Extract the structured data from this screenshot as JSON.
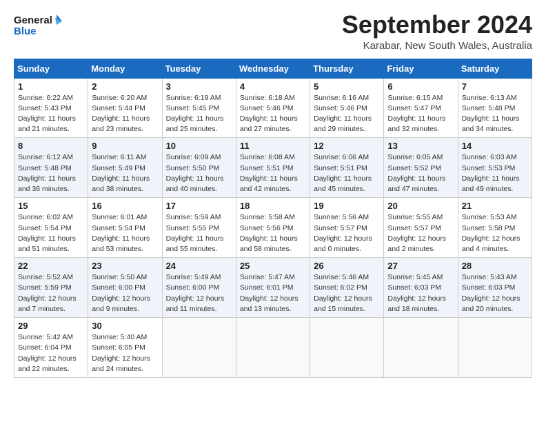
{
  "header": {
    "logo_line1": "General",
    "logo_line2": "Blue",
    "month_title": "September 2024",
    "location": "Karabar, New South Wales, Australia"
  },
  "weekdays": [
    "Sunday",
    "Monday",
    "Tuesday",
    "Wednesday",
    "Thursday",
    "Friday",
    "Saturday"
  ],
  "weeks": [
    [
      {
        "day": "1",
        "sunrise": "6:22 AM",
        "sunset": "5:43 PM",
        "daylight": "11 hours and 21 minutes."
      },
      {
        "day": "2",
        "sunrise": "6:20 AM",
        "sunset": "5:44 PM",
        "daylight": "11 hours and 23 minutes."
      },
      {
        "day": "3",
        "sunrise": "6:19 AM",
        "sunset": "5:45 PM",
        "daylight": "11 hours and 25 minutes."
      },
      {
        "day": "4",
        "sunrise": "6:18 AM",
        "sunset": "5:46 PM",
        "daylight": "11 hours and 27 minutes."
      },
      {
        "day": "5",
        "sunrise": "6:16 AM",
        "sunset": "5:46 PM",
        "daylight": "11 hours and 29 minutes."
      },
      {
        "day": "6",
        "sunrise": "6:15 AM",
        "sunset": "5:47 PM",
        "daylight": "11 hours and 32 minutes."
      },
      {
        "day": "7",
        "sunrise": "6:13 AM",
        "sunset": "5:48 PM",
        "daylight": "11 hours and 34 minutes."
      }
    ],
    [
      {
        "day": "8",
        "sunrise": "6:12 AM",
        "sunset": "5:48 PM",
        "daylight": "11 hours and 36 minutes."
      },
      {
        "day": "9",
        "sunrise": "6:11 AM",
        "sunset": "5:49 PM",
        "daylight": "11 hours and 38 minutes."
      },
      {
        "day": "10",
        "sunrise": "6:09 AM",
        "sunset": "5:50 PM",
        "daylight": "11 hours and 40 minutes."
      },
      {
        "day": "11",
        "sunrise": "6:08 AM",
        "sunset": "5:51 PM",
        "daylight": "11 hours and 42 minutes."
      },
      {
        "day": "12",
        "sunrise": "6:06 AM",
        "sunset": "5:51 PM",
        "daylight": "11 hours and 45 minutes."
      },
      {
        "day": "13",
        "sunrise": "6:05 AM",
        "sunset": "5:52 PM",
        "daylight": "11 hours and 47 minutes."
      },
      {
        "day": "14",
        "sunrise": "6:03 AM",
        "sunset": "5:53 PM",
        "daylight": "11 hours and 49 minutes."
      }
    ],
    [
      {
        "day": "15",
        "sunrise": "6:02 AM",
        "sunset": "5:54 PM",
        "daylight": "11 hours and 51 minutes."
      },
      {
        "day": "16",
        "sunrise": "6:01 AM",
        "sunset": "5:54 PM",
        "daylight": "11 hours and 53 minutes."
      },
      {
        "day": "17",
        "sunrise": "5:59 AM",
        "sunset": "5:55 PM",
        "daylight": "11 hours and 55 minutes."
      },
      {
        "day": "18",
        "sunrise": "5:58 AM",
        "sunset": "5:56 PM",
        "daylight": "11 hours and 58 minutes."
      },
      {
        "day": "19",
        "sunrise": "5:56 AM",
        "sunset": "5:57 PM",
        "daylight": "12 hours and 0 minutes."
      },
      {
        "day": "20",
        "sunrise": "5:55 AM",
        "sunset": "5:57 PM",
        "daylight": "12 hours and 2 minutes."
      },
      {
        "day": "21",
        "sunrise": "5:53 AM",
        "sunset": "5:58 PM",
        "daylight": "12 hours and 4 minutes."
      }
    ],
    [
      {
        "day": "22",
        "sunrise": "5:52 AM",
        "sunset": "5:59 PM",
        "daylight": "12 hours and 7 minutes."
      },
      {
        "day": "23",
        "sunrise": "5:50 AM",
        "sunset": "6:00 PM",
        "daylight": "12 hours and 9 minutes."
      },
      {
        "day": "24",
        "sunrise": "5:49 AM",
        "sunset": "6:00 PM",
        "daylight": "12 hours and 11 minutes."
      },
      {
        "day": "25",
        "sunrise": "5:47 AM",
        "sunset": "6:01 PM",
        "daylight": "12 hours and 13 minutes."
      },
      {
        "day": "26",
        "sunrise": "5:46 AM",
        "sunset": "6:02 PM",
        "daylight": "12 hours and 15 minutes."
      },
      {
        "day": "27",
        "sunrise": "5:45 AM",
        "sunset": "6:03 PM",
        "daylight": "12 hours and 18 minutes."
      },
      {
        "day": "28",
        "sunrise": "5:43 AM",
        "sunset": "6:03 PM",
        "daylight": "12 hours and 20 minutes."
      }
    ],
    [
      {
        "day": "29",
        "sunrise": "5:42 AM",
        "sunset": "6:04 PM",
        "daylight": "12 hours and 22 minutes."
      },
      {
        "day": "30",
        "sunrise": "5:40 AM",
        "sunset": "6:05 PM",
        "daylight": "12 hours and 24 minutes."
      },
      null,
      null,
      null,
      null,
      null
    ]
  ]
}
